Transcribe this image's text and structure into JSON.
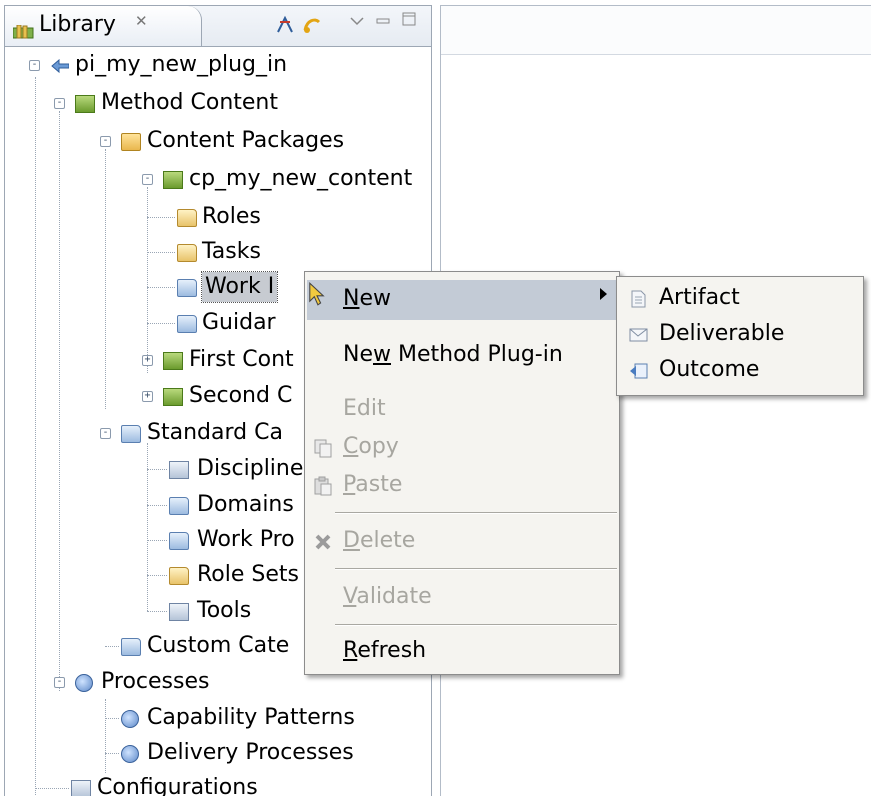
{
  "library_view": {
    "title": "Library",
    "close_glyph": "✕",
    "toolbar_icons": [
      "link-icon",
      "sync-icon",
      "view-menu-icon",
      "minimize-icon",
      "maximize-icon"
    ]
  },
  "tree": [
    {
      "label": "pi_my_new_plug_in",
      "icon": "plugin-icon"
    },
    {
      "label": "Method Content",
      "icon": "method-content-icon"
    },
    {
      "label": "Content Packages",
      "icon": "content-packages-icon"
    },
    {
      "label": "cp_my_new_content",
      "icon": "content-package-icon"
    },
    {
      "label": "Roles",
      "icon": "roles-folder-icon"
    },
    {
      "label": "Tasks",
      "icon": "tasks-folder-icon"
    },
    {
      "label": "Work I",
      "icon": "work-products-folder-icon"
    },
    {
      "label": "Guidar",
      "icon": "guidance-folder-icon"
    },
    {
      "label": "First Cont",
      "icon": "content-package-icon"
    },
    {
      "label": "Second C",
      "icon": "content-package-icon"
    },
    {
      "label": "Standard Ca",
      "icon": "standard-categories-icon"
    },
    {
      "label": "Discipline",
      "icon": "disciplines-icon"
    },
    {
      "label": "Domains",
      "icon": "domains-icon"
    },
    {
      "label": "Work Pro",
      "icon": "work-product-kinds-icon"
    },
    {
      "label": "Role Sets",
      "icon": "role-sets-icon"
    },
    {
      "label": "Tools",
      "icon": "tools-icon"
    },
    {
      "label": "Custom Cate",
      "icon": "custom-categories-icon"
    },
    {
      "label": "Processes",
      "icon": "processes-icon"
    },
    {
      "label": "Capability Patterns",
      "icon": "capability-patterns-icon"
    },
    {
      "label": "Delivery Processes",
      "icon": "delivery-processes-icon"
    },
    {
      "label": "Configurations",
      "icon": "configurations-icon"
    }
  ],
  "context_menu": {
    "new": {
      "pre": "",
      "u": "N",
      "post": "ew"
    },
    "new_plugin": {
      "pre": "Ne",
      "u": "w",
      "post": " Method Plug-in"
    },
    "edit": {
      "pre": "Edit",
      "u": "",
      "post": ""
    },
    "copy": {
      "pre": "",
      "u": "C",
      "post": "opy"
    },
    "paste": {
      "pre": "",
      "u": "P",
      "post": "aste"
    },
    "delete": {
      "pre": "",
      "u": "D",
      "post": "elete"
    },
    "validate": {
      "pre": "",
      "u": "V",
      "post": "alidate"
    },
    "refresh": {
      "pre": "",
      "u": "R",
      "post": "efresh"
    }
  },
  "submenu": {
    "items": [
      "Artifact",
      "Deliverable",
      "Outcome"
    ]
  },
  "colors": {
    "menu_bg": "#f5f4f0",
    "highlight": "#c3cbd6",
    "disabled_text": "#a7a6a0"
  }
}
